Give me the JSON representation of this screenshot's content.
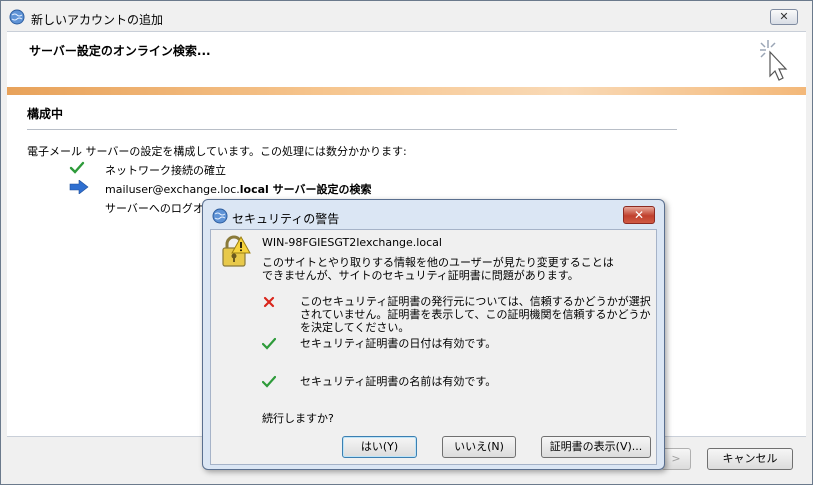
{
  "window": {
    "title": "新しいアカウントの追加",
    "close_label": "✕"
  },
  "header": {
    "heading": "サーバー設定のオンライン検索..."
  },
  "section": {
    "title": "構成中",
    "description": "電子メール サーバーの設定を構成しています。この処理には数分かかります:"
  },
  "steps": [
    {
      "icon": "check-icon",
      "text": "ネットワーク接続の確立",
      "status": "done"
    },
    {
      "icon": "arrow-right-icon",
      "text_prefix": "mailuser@exchange.loc.",
      "text_bold": "local サーバー設定の検索",
      "status": "in-progress"
    },
    {
      "icon": "none",
      "text": "サーバーへのログオン",
      "status": "pending"
    }
  ],
  "footer": {
    "next_label": ">",
    "cancel_label": "キャンセル"
  },
  "security_dialog": {
    "title": "セキュリティの警告",
    "close_label": "✕",
    "host": "WIN-98FGIESGT2Iexchange.local",
    "message": "このサイトとやり取りする情報を他のユーザーが見たり変更することはできませんが、サイトのセキュリティ証明書に問題があります。",
    "checks": [
      {
        "icon": "error-x-icon",
        "status": "error",
        "text": "このセキュリティ証明書の発行元については、信頼するかどうかが選択されていません。証明書を表示して、この証明機関を信頼するかどうかを決定してください。"
      },
      {
        "icon": "check-icon",
        "status": "ok",
        "text": "セキュリティ証明書の日付は有効です。"
      },
      {
        "icon": "check-icon",
        "status": "ok",
        "text": "セキュリティ証明書の名前は有効です。"
      }
    ],
    "prompt": "続行しますか?",
    "buttons": {
      "yes": "はい(Y)",
      "no": "いいえ(N)",
      "view_cert": "証明書の表示(V)..."
    }
  },
  "colors": {
    "accent_orange": "#f3b879",
    "check_green": "#2e9b3a",
    "error_red": "#d9261c",
    "arrow_blue": "#2f6fd0"
  }
}
